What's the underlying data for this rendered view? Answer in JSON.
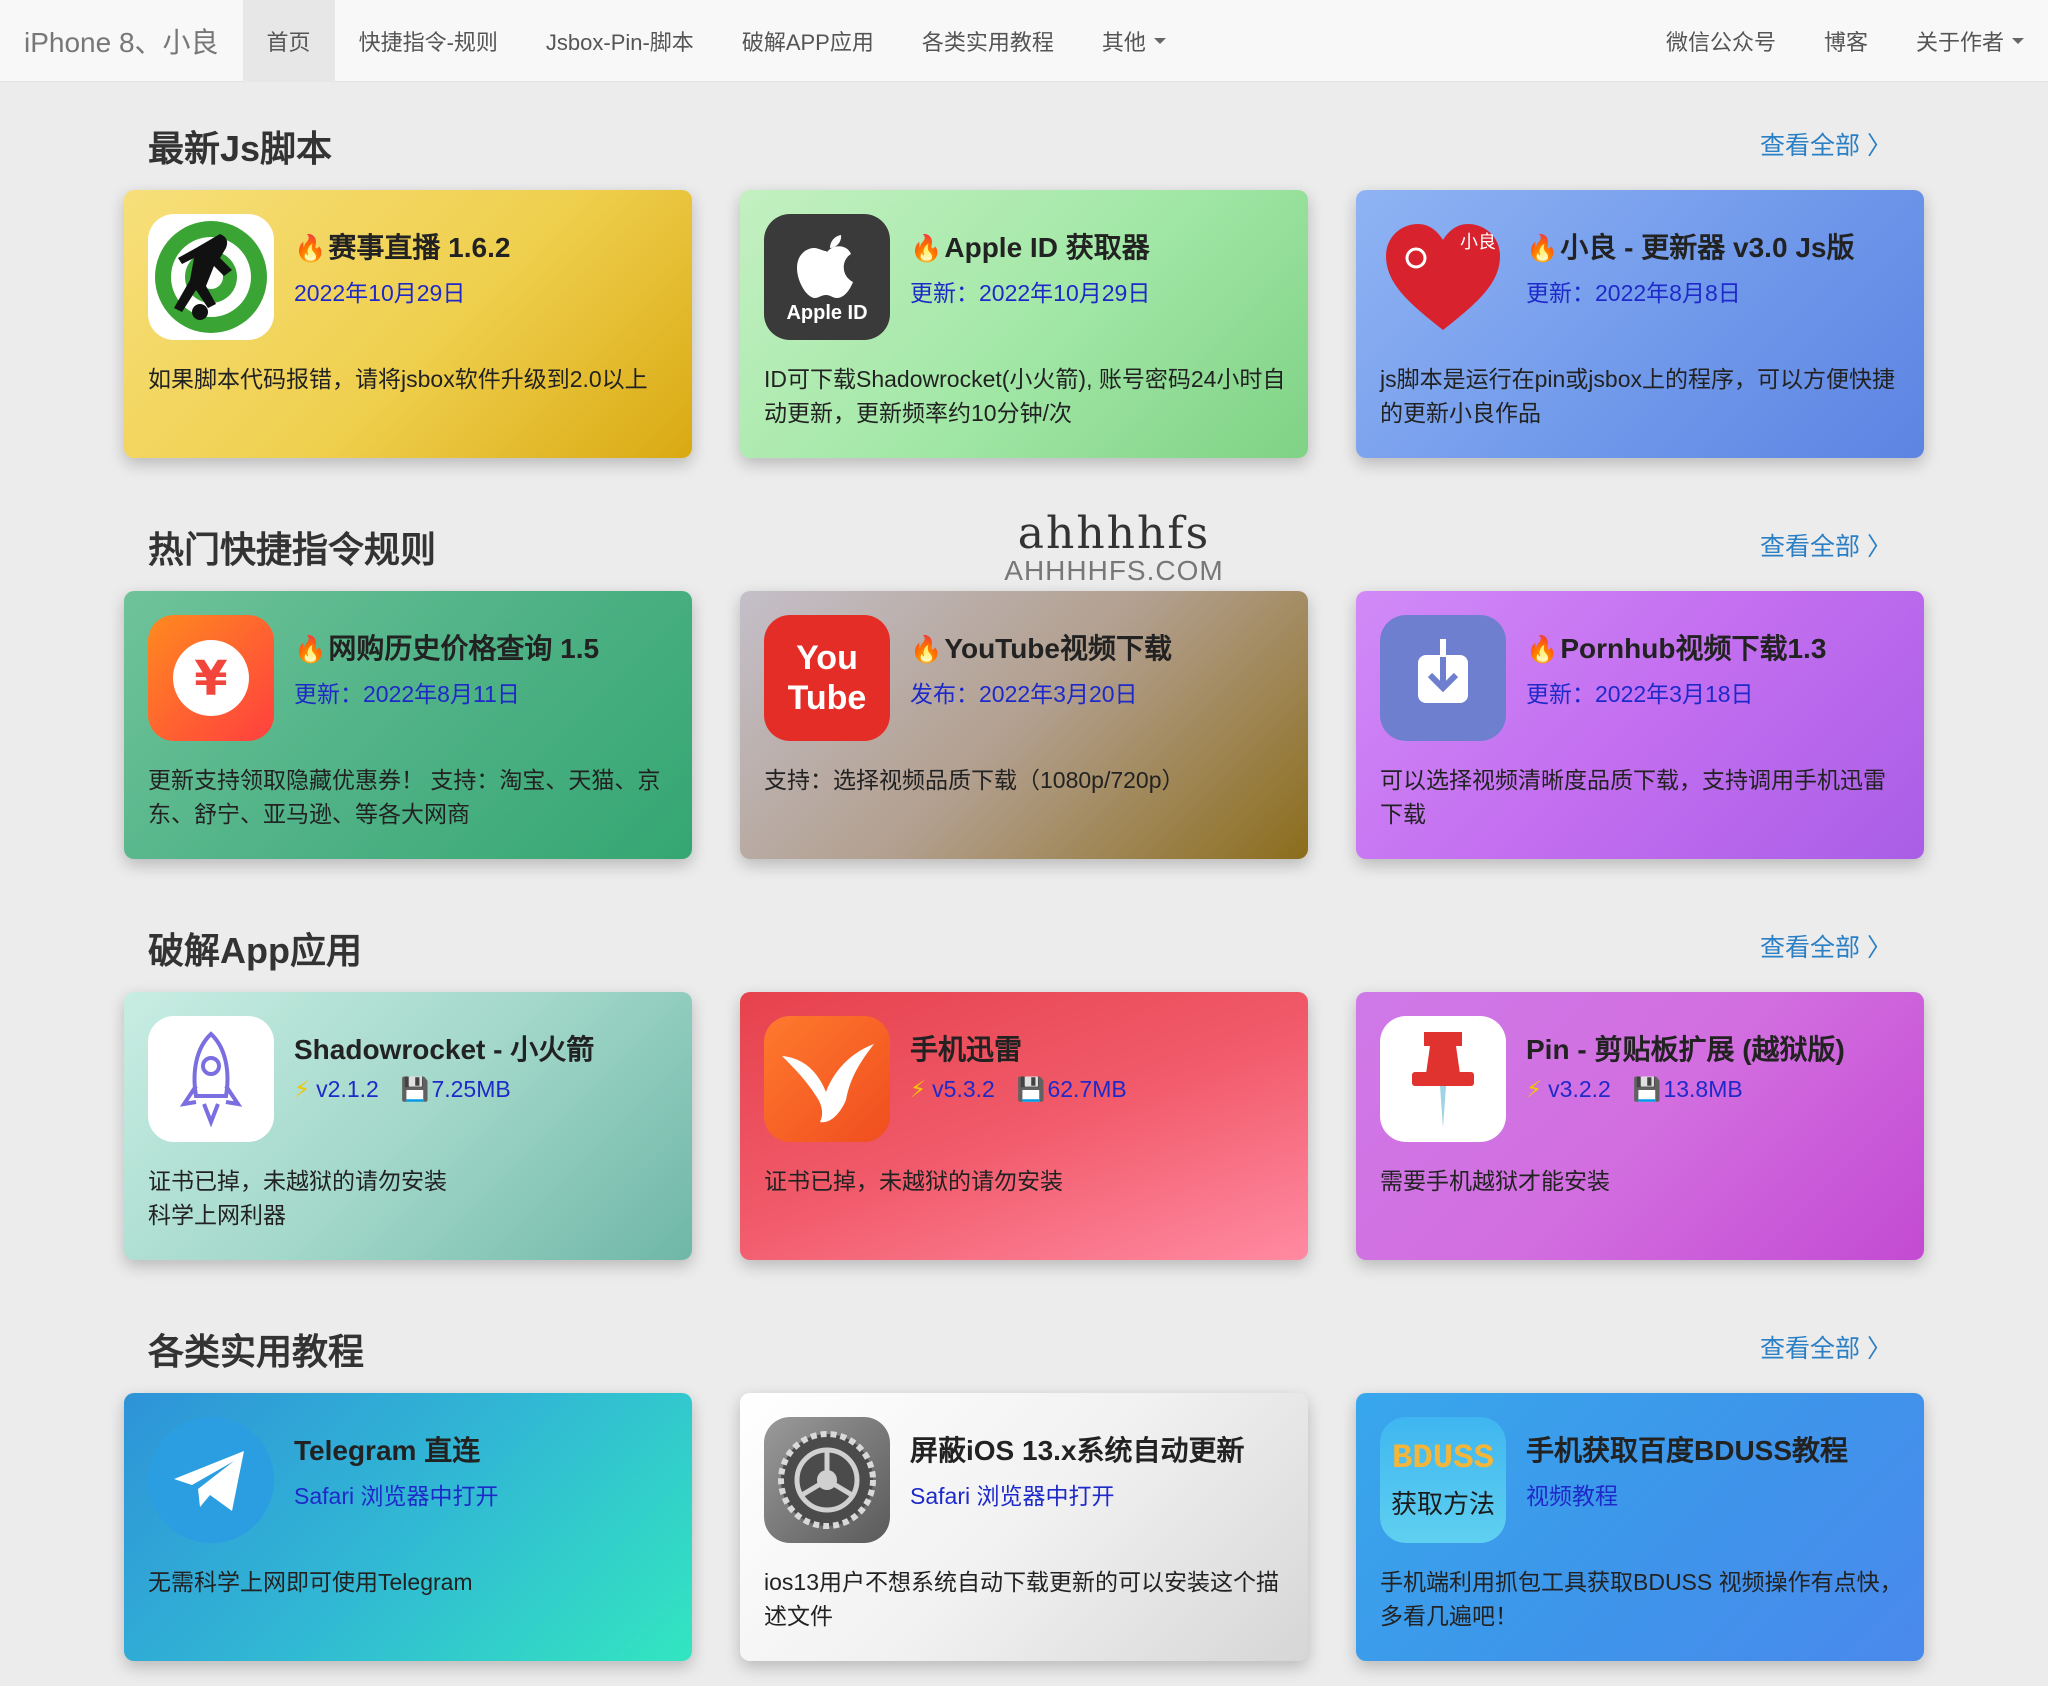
{
  "nav": {
    "brand": "iPhone 8、小良",
    "items": [
      "首页",
      "快捷指令-规则",
      "Jsbox-Pin-脚本",
      "破解APP应用",
      "各类实用教程",
      "其他"
    ],
    "right": [
      "微信公众号",
      "博客",
      "关于作者"
    ]
  },
  "watermark": {
    "top": "ahhhhfs",
    "bottom": "AHHHHFS.COM"
  },
  "sections": [
    {
      "title": "最新Js脚本",
      "view_all": "查看全部 〉",
      "cards": [
        {
          "title": "赛事直播 1.6.2",
          "meta": "2022年10月29日",
          "desc": "如果脚本代码报错，请将jsbox软件升级到2.0以上",
          "icon": "soccer-player-icon"
        },
        {
          "title": "Apple ID 获取器",
          "meta": "更新：2022年10月29日",
          "desc": "ID可下载Shadowrocket(小火箭), 账号密码24小时自动更新，更新频率约10分钟/次",
          "icon": "apple-id-icon",
          "icon_label": "Apple ID"
        },
        {
          "title": "小良 - 更新器 v3.0 Js版",
          "meta": "更新：2022年8月8日",
          "desc": "js脚本是运行在pin或jsbox上的程序，可以方便快捷的更新小良作品",
          "icon": "heart-icon",
          "icon_label": "小良"
        }
      ]
    },
    {
      "title": "热门快捷指令规则",
      "view_all": "查看全部 〉",
      "cards": [
        {
          "title": "网购历史价格查询 1.5",
          "meta": "更新：2022年8月11日",
          "desc": "更新支持领取隐藏优惠券！ 支持：淘宝、天猫、京东、舒宁、亚马逊、等各大网商",
          "icon": "yen-icon"
        },
        {
          "title": "YouTube视频下载",
          "meta": "发布：2022年3月20日",
          "desc": "支持：选择视频品质下载（1080p/720p）",
          "icon": "youtube-icon",
          "icon_label_1": "You",
          "icon_label_2": "Tube"
        },
        {
          "title": "Pornhub视频下载1.3",
          "meta": "更新：2022年3月18日",
          "desc": "可以选择视频清晰度品质下载，支持调用手机迅雷下载",
          "icon": "download-icon"
        }
      ]
    },
    {
      "title": "破解App应用",
      "view_all": "查看全部 〉",
      "cards": [
        {
          "title": "Shadowrocket - 小火箭",
          "version": "v2.1.2",
          "size": "7.25MB",
          "desc": "证书已掉，未越狱的请勿安装\n科学上网利器",
          "icon": "rocket-icon"
        },
        {
          "title": "手机迅雷",
          "version": "v5.3.2",
          "size": "62.7MB",
          "desc": "证书已掉，未越狱的请勿安装",
          "icon": "bird-icon"
        },
        {
          "title": "Pin - 剪贴板扩展 (越狱版)",
          "version": "v3.2.2",
          "size": "13.8MB",
          "desc": "需要手机越狱才能安装",
          "icon": "pushpin-icon"
        }
      ]
    },
    {
      "title": "各类实用教程",
      "view_all": "查看全部 〉",
      "cards": [
        {
          "title": "Telegram 直连",
          "meta": "Safari 浏览器中打开",
          "desc": "无需科学上网即可使用Telegram",
          "icon": "telegram-icon"
        },
        {
          "title": "屏蔽iOS 13.x系统自动更新",
          "meta": "Safari 浏览器中打开",
          "desc": "ios13用户不想系统自动下载更新的可以安装这个描述文件",
          "icon": "settings-gear-icon"
        },
        {
          "title": "手机获取百度BDUSS教程",
          "meta": "视频教程",
          "desc": "手机端利用抓包工具获取BDUSS 视频操作有点快，多看几遍吧！",
          "icon": "bduss-icon",
          "icon_label_1": "BDUSS",
          "icon_label_2": "获取方法"
        }
      ]
    }
  ]
}
